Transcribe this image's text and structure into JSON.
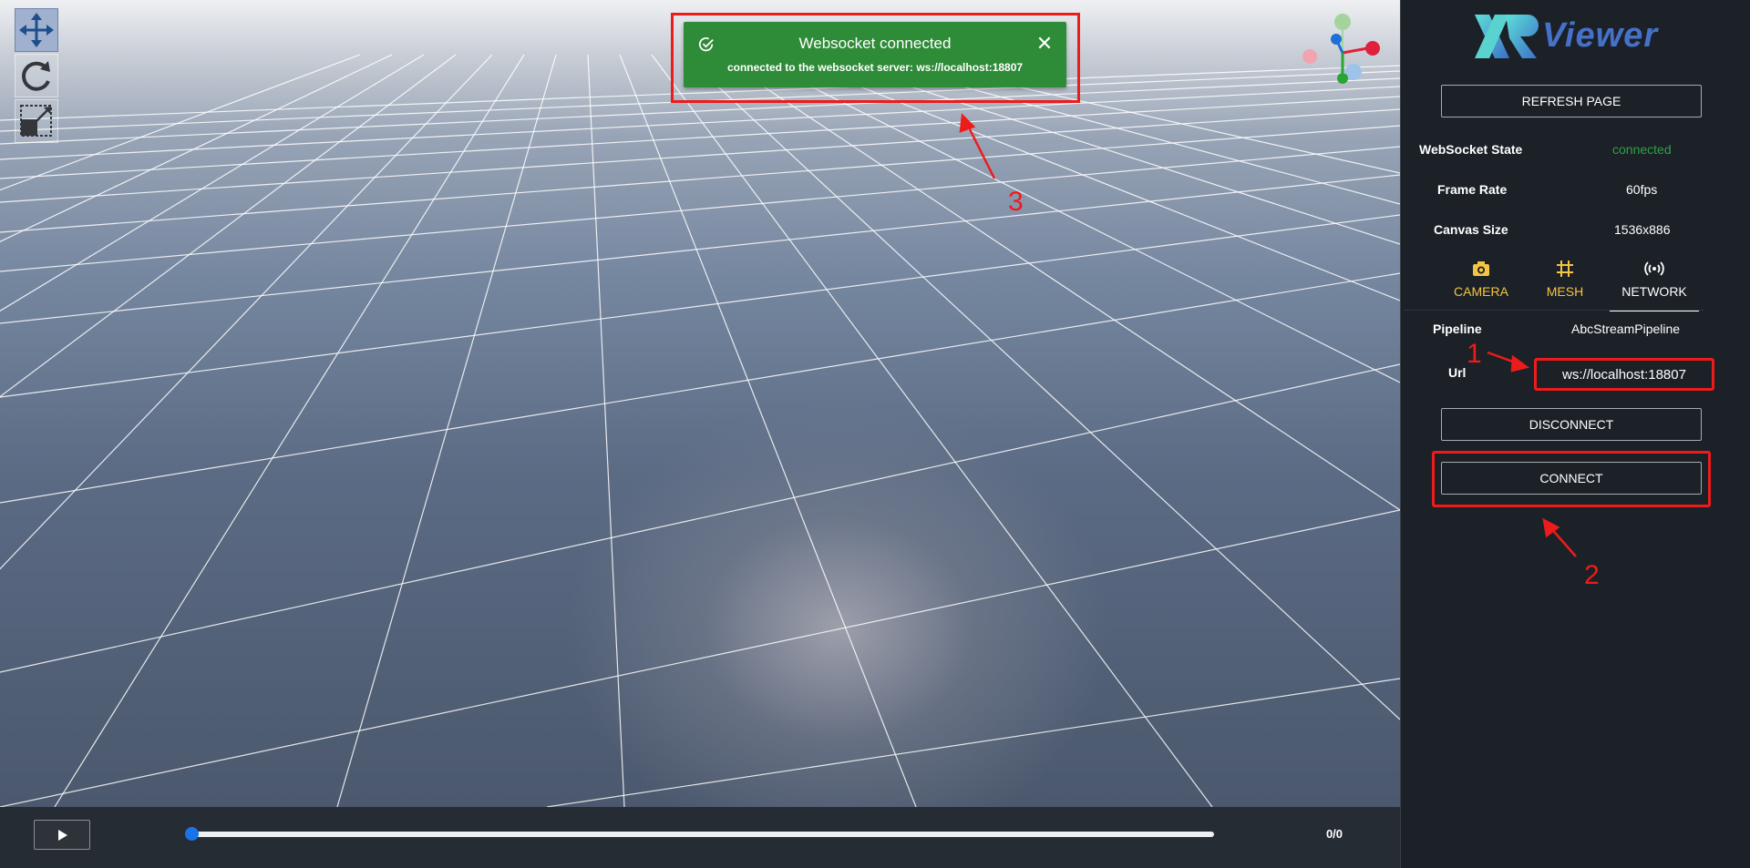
{
  "toolbar": {
    "items": [
      {
        "name": "move-tool",
        "icon": "move-arrows-icon",
        "active": true
      },
      {
        "name": "rotate-tool",
        "icon": "rotate-icon",
        "active": false
      },
      {
        "name": "scale-tool",
        "icon": "scale-icon",
        "active": false
      }
    ]
  },
  "toast": {
    "title": "Websocket connected",
    "message_prefix": "connected to the websocket server: ",
    "message_url": "ws://localhost:18807",
    "close_icon": "close-icon",
    "color": "#2e8b38"
  },
  "player": {
    "play_icon": "play-icon",
    "counter": "0/0",
    "progress": 0
  },
  "sidebar": {
    "logo_text": "Viewer",
    "logo_mark": "XR",
    "refresh_label": "REFRESH PAGE",
    "info": [
      {
        "label": "WebSocket State",
        "value": "connected",
        "color": "#2ea043"
      },
      {
        "label": "Frame Rate",
        "value": "60fps"
      },
      {
        "label": "Canvas Size",
        "value": "1536x886"
      }
    ],
    "tabs": [
      {
        "label": "CAMERA",
        "icon": "camera-icon",
        "active": false,
        "color": "#f4c542"
      },
      {
        "label": "MESH",
        "icon": "grid-icon",
        "active": false,
        "color": "#f4c542"
      },
      {
        "label": "NETWORK",
        "icon": "broadcast-icon",
        "active": true,
        "color": "#ffffff"
      }
    ],
    "network": {
      "pipeline_label": "Pipeline",
      "pipeline_value": "AbcStreamPipeline",
      "url_label": "Url",
      "url_value": "ws://localhost:18807",
      "disconnect_label": "DISCONNECT",
      "connect_label": "CONNECT"
    }
  },
  "annotations": {
    "one": "1",
    "two": "2",
    "three": "3"
  }
}
